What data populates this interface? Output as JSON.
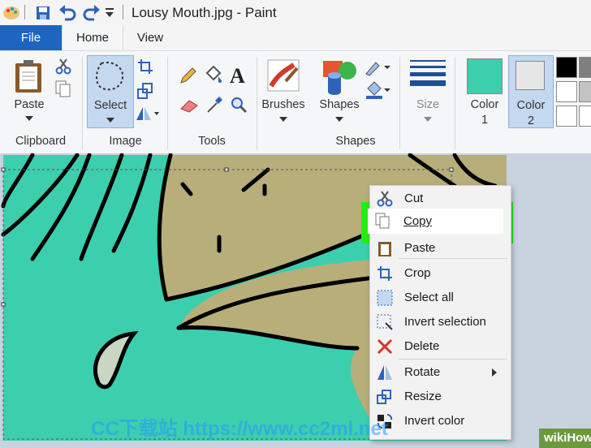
{
  "window": {
    "title": "Lousy Mouth.jpg - Paint"
  },
  "tabs": {
    "file": "File",
    "home": "Home",
    "view": "View"
  },
  "ribbon": {
    "paste": "Paste",
    "select": "Select",
    "brushes": "Brushes",
    "shapes": "Shapes",
    "size": "Size",
    "color1": "Color",
    "color1_num": "1",
    "color2": "Color",
    "color2_num": "2",
    "groups": {
      "clipboard": "Clipboard",
      "image": "Image",
      "tools": "Tools",
      "shapes": "Shapes"
    },
    "colors": {
      "color1": "#3ccfad",
      "color2": "#e6e6e6"
    }
  },
  "context_menu": {
    "cut": "Cut",
    "copy": "Copy",
    "paste": "Paste",
    "crop": "Crop",
    "select_all": "Select all",
    "invert_selection": "Invert selection",
    "delete": "Delete",
    "rotate": "Rotate",
    "resize": "Resize",
    "invert_color": "Invert color"
  },
  "watermark": {
    "text": "CC下载站 https://www.cc2ml.net",
    "brand": "wikiHow"
  }
}
